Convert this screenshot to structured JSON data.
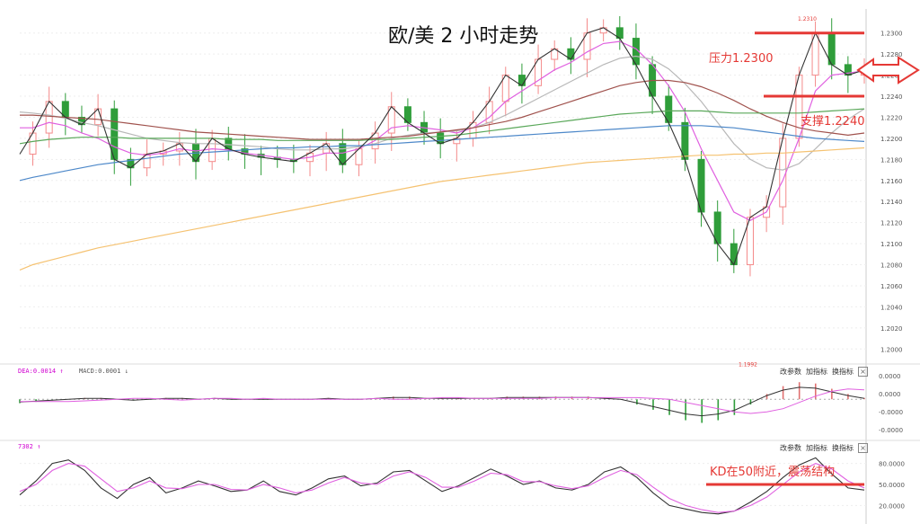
{
  "header": {
    "title": "欧/美  2 小时走势"
  },
  "annotations": {
    "resistance": "压力1.2300",
    "support": "支撑1.2240",
    "kd_note": "KD在50附近，震荡结构",
    "high_marker": "1.2310",
    "low_marker": "1.1992"
  },
  "toolbar": {
    "macd": {
      "dea": "DEA:0.0014 ↑",
      "macd": "MACD:0.0001 ↓"
    },
    "kd": {
      "value": "7302 ↑"
    },
    "buttons": [
      "改参数",
      "加指标",
      "换指标"
    ],
    "close": "×"
  },
  "colors": {
    "up": "#f48a8a",
    "down": "#2f9d3a",
    "resistance_line": "#e53935",
    "ma_dark": "#333333",
    "ma_pink": "#e060e0",
    "ma_gray": "#b8b8b8",
    "ma_brown": "#a0524d",
    "ma_green": "#5aa85a",
    "ma_blue": "#4d88c9",
    "ma_orange": "#f5c271"
  },
  "chart_data": [
    {
      "type": "line",
      "title": "欧/美  2 小时走势",
      "xlabel": "",
      "ylabel": "",
      "ylim": [
        1.199,
        1.231
      ],
      "yticks": [
        "1.2300",
        "1.2280",
        "1.2260",
        "1.2240",
        "1.2220",
        "1.2200",
        "1.2180",
        "1.2160",
        "1.2140",
        "1.2120",
        "1.2100",
        "1.2080",
        "1.2060",
        "1.2040",
        "1.2020",
        "1.2000"
      ],
      "x": [
        1,
        5,
        10,
        15,
        20,
        25,
        30,
        35,
        40,
        45,
        50,
        55,
        60,
        65,
        70,
        75,
        80,
        85,
        90,
        95,
        100,
        105,
        110,
        115,
        120,
        125,
        130,
        135,
        140,
        145,
        150,
        155,
        160,
        165,
        170,
        175,
        180,
        185,
        190,
        195,
        200,
        205,
        210,
        215,
        220,
        225,
        230,
        235,
        240,
        245,
        250,
        255,
        260
      ],
      "series": [
        {
          "values": [
            1.2185,
            1.2205,
            1.2235,
            1.222,
            1.2213,
            1.2228,
            1.218,
            1.2172,
            1.2185,
            1.2188,
            1.2195,
            1.2178,
            1.22,
            1.219,
            1.2185,
            1.2182,
            1.218,
            1.2178,
            1.2186,
            1.2195,
            1.2175,
            1.219,
            1.2205,
            1.223,
            1.2215,
            1.2205,
            1.2195,
            1.22,
            1.2215,
            1.2235,
            1.226,
            1.225,
            1.2275,
            1.2285,
            1.2275,
            1.23,
            1.2305,
            1.2295,
            1.227,
            1.224,
            1.2215,
            1.218,
            1.213,
            1.21,
            1.208,
            1.2125,
            1.2135,
            1.22,
            1.226,
            1.23,
            1.227,
            1.226,
            1.2265
          ]
        },
        {
          "values": [
            1.221,
            1.221,
            1.2215,
            1.2212,
            1.2205,
            1.22,
            1.2192,
            1.2186,
            1.2184,
            1.2186,
            1.219,
            1.2188,
            1.219,
            1.2189,
            1.2186,
            1.2184,
            1.2182,
            1.218,
            1.2182,
            1.2186,
            1.2186,
            1.219,
            1.2198,
            1.221,
            1.2212,
            1.221,
            1.2208,
            1.2205,
            1.221,
            1.222,
            1.2235,
            1.2245,
            1.2255,
            1.2265,
            1.2272,
            1.2282,
            1.229,
            1.2292,
            1.2285,
            1.227,
            1.225,
            1.2225,
            1.219,
            1.216,
            1.213,
            1.2122,
            1.213,
            1.216,
            1.22,
            1.2245,
            1.226,
            1.2262,
            1.2264
          ]
        },
        {
          "values": [
            1.2225,
            1.2224,
            1.2222,
            1.2219,
            1.2215,
            1.2212,
            1.2208,
            1.2204,
            1.22,
            1.2198,
            1.2196,
            1.2195,
            1.2195,
            1.2194,
            1.2193,
            1.2192,
            1.219,
            1.2189,
            1.2189,
            1.219,
            1.219,
            1.2192,
            1.2195,
            1.22,
            1.2203,
            1.2205,
            1.2206,
            1.2207,
            1.221,
            1.2215,
            1.2222,
            1.223,
            1.2238,
            1.2246,
            1.2254,
            1.2262,
            1.227,
            1.2276,
            1.2278,
            1.2275,
            1.2266,
            1.2252,
            1.2235,
            1.2215,
            1.2195,
            1.218,
            1.2172,
            1.217,
            1.2176,
            1.219,
            1.2205,
            1.2218,
            1.2228
          ]
        },
        {
          "values": [
            1.2222,
            1.2222,
            1.2221,
            1.222,
            1.2219,
            1.2218,
            1.2216,
            1.2214,
            1.2212,
            1.221,
            1.2208,
            1.2206,
            1.2205,
            1.2204,
            1.2203,
            1.2202,
            1.2201,
            1.22,
            1.2199,
            1.2199,
            1.2199,
            1.2199,
            1.22,
            1.2201,
            1.2202,
            1.2204,
            1.2206,
            1.2208,
            1.221,
            1.2213,
            1.2216,
            1.222,
            1.2225,
            1.223,
            1.2235,
            1.224,
            1.2245,
            1.225,
            1.2253,
            1.2255,
            1.2255,
            1.2253,
            1.2249,
            1.2243,
            1.2236,
            1.2228,
            1.2221,
            1.2215,
            1.221,
            1.2207,
            1.2205,
            1.2203,
            1.2205
          ]
        },
        {
          "values": [
            1.2195,
            1.2197,
            1.2199,
            1.22,
            1.2201,
            1.2201,
            1.2201,
            1.22,
            1.22,
            1.22,
            1.22,
            1.22,
            1.22,
            1.2199,
            1.2199,
            1.2199,
            1.2198,
            1.2198,
            1.2198,
            1.2198,
            1.2198,
            1.2198,
            1.2199,
            1.2199,
            1.22,
            1.2201,
            1.2202,
            1.2203,
            1.2205,
            1.2207,
            1.2209,
            1.2211,
            1.2213,
            1.2215,
            1.2217,
            1.2219,
            1.2221,
            1.2223,
            1.2224,
            1.2225,
            1.2226,
            1.2226,
            1.2226,
            1.2225,
            1.2224,
            1.2224,
            1.2224,
            1.2224,
            1.2224,
            1.2225,
            1.2226,
            1.2227,
            1.2228
          ]
        },
        {
          "values": [
            1.216,
            1.2163,
            1.2166,
            1.2169,
            1.2172,
            1.2175,
            1.2177,
            1.2179,
            1.2181,
            1.2183,
            1.2185,
            1.2186,
            1.2187,
            1.2188,
            1.2189,
            1.219,
            1.2191,
            1.2191,
            1.2192,
            1.2192,
            1.2193,
            1.2193,
            1.2194,
            1.2195,
            1.2196,
            1.2197,
            1.2198,
            1.2199,
            1.22,
            1.2201,
            1.2202,
            1.2203,
            1.2204,
            1.2205,
            1.2206,
            1.2207,
            1.2208,
            1.2209,
            1.221,
            1.2211,
            1.2212,
            1.2212,
            1.2212,
            1.2211,
            1.221,
            1.2208,
            1.2206,
            1.2204,
            1.2202,
            1.22,
            1.2199,
            1.2198,
            1.2197
          ]
        },
        {
          "values": [
            1.2075,
            1.208,
            1.2084,
            1.2088,
            1.2092,
            1.2096,
            1.2099,
            1.2102,
            1.2105,
            1.2108,
            1.2111,
            1.2114,
            1.2117,
            1.212,
            1.2123,
            1.2126,
            1.2129,
            1.2132,
            1.2135,
            1.2138,
            1.2141,
            1.2144,
            1.2147,
            1.215,
            1.2153,
            1.2156,
            1.2159,
            1.2161,
            1.2163,
            1.2165,
            1.2167,
            1.2169,
            1.2171,
            1.2173,
            1.2175,
            1.2177,
            1.2178,
            1.2179,
            1.218,
            1.2181,
            1.2182,
            1.2183,
            1.2184,
            1.2184,
            1.2185,
            1.2185,
            1.2186,
            1.2186,
            1.2187,
            1.2188,
            1.2189,
            1.219,
            1.2191
          ]
        }
      ],
      "reference_lines": [
        1.23,
        1.224
      ]
    },
    {
      "type": "bar",
      "title": "",
      "ylim": [
        -0.003,
        0.002
      ],
      "yticks": [
        "0.0000",
        "0.0000",
        "-0.0000",
        "-0.0000"
      ],
      "values": [
        -0.0003,
        -0.0002,
        -0.0001,
        0.0,
        0.0001,
        0.0001,
        0.0,
        -0.0001,
        0.0,
        0.0001,
        0.0001,
        0.0,
        0.0001,
        0.0,
        0.0,
        0.0,
        0.0,
        0.0,
        0.0,
        0.0001,
        0.0,
        0.0,
        0.0001,
        0.0002,
        0.0002,
        0.0001,
        0.0001,
        0.0001,
        0.0001,
        0.0001,
        0.0002,
        0.0002,
        0.0002,
        0.0002,
        0.0002,
        0.0002,
        0.0001,
        0.0,
        -0.0004,
        -0.0008,
        -0.0012,
        -0.0016,
        -0.0018,
        -0.0016,
        -0.0012,
        -0.0004,
        0.0004,
        0.001,
        0.0013,
        0.0012,
        0.0008,
        0.0004,
        0.0001
      ]
    },
    {
      "type": "line",
      "title": "",
      "ylim": [
        0,
        100
      ],
      "yticks": [
        "80.0000",
        "50.0000",
        "20.0000"
      ],
      "reference_lines": [
        50
      ],
      "series": [
        {
          "values": [
            35,
            55,
            80,
            85,
            70,
            45,
            30,
            50,
            60,
            38,
            45,
            55,
            48,
            40,
            42,
            55,
            40,
            35,
            45,
            58,
            62,
            48,
            52,
            68,
            70,
            55,
            40,
            48,
            60,
            72,
            62,
            50,
            55,
            45,
            42,
            50,
            68,
            75,
            60,
            38,
            20,
            15,
            10,
            8,
            12,
            25,
            40,
            60,
            78,
            88,
            65,
            45,
            42
          ]
        },
        {
          "values": [
            40,
            50,
            70,
            80,
            76,
            58,
            40,
            45,
            55,
            45,
            44,
            50,
            50,
            43,
            42,
            50,
            45,
            38,
            42,
            52,
            60,
            52,
            50,
            62,
            68,
            60,
            46,
            46,
            55,
            66,
            64,
            54,
            54,
            48,
            44,
            48,
            60,
            70,
            64,
            46,
            30,
            20,
            14,
            10,
            12,
            20,
            32,
            50,
            68,
            80,
            72,
            55,
            45
          ]
        }
      ]
    }
  ]
}
